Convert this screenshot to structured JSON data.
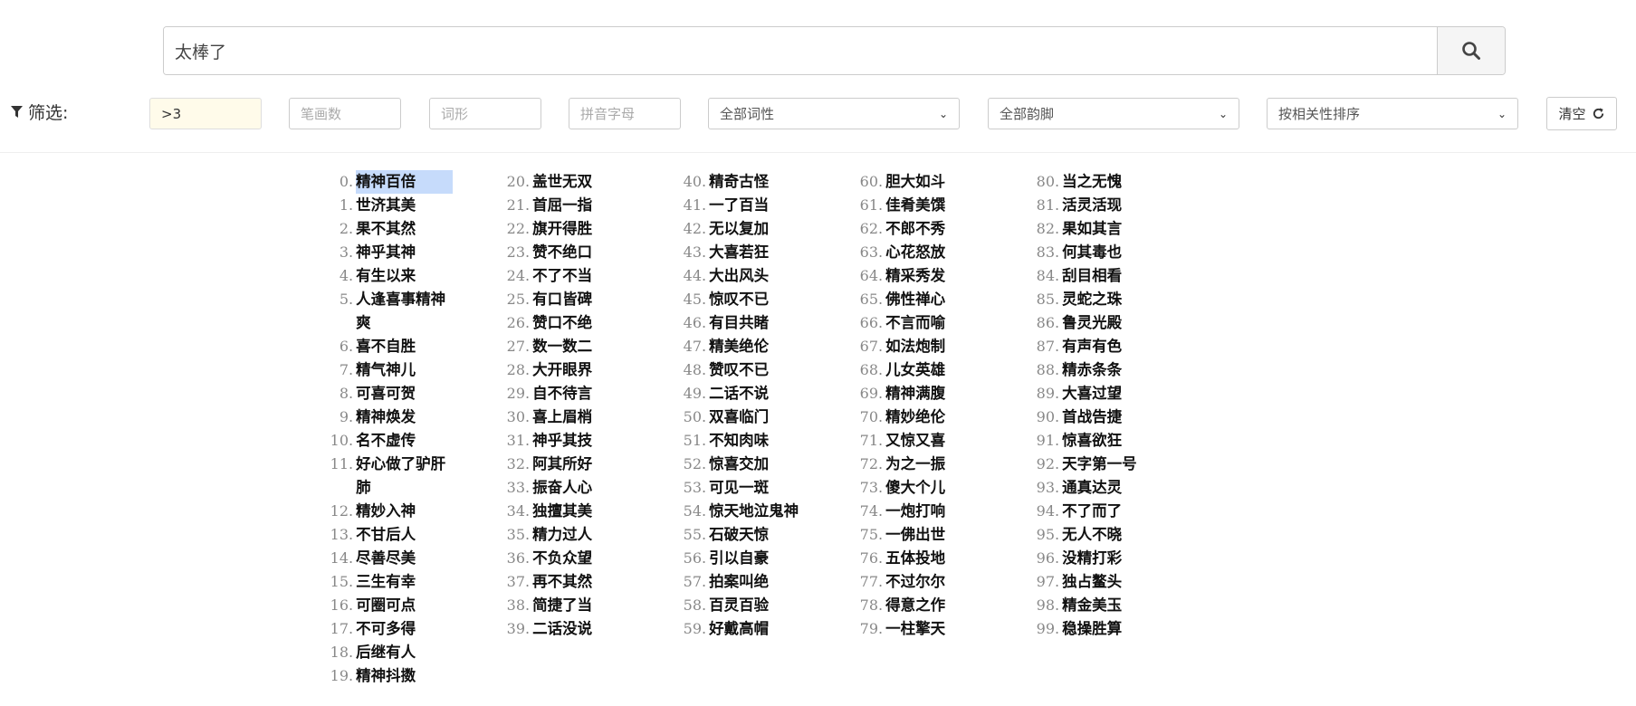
{
  "search": {
    "value": "太棒了"
  },
  "filters": {
    "label": "筛选:",
    "length_value": ">3",
    "strokes_placeholder": "笔画数",
    "form_placeholder": "词形",
    "pinyin_placeholder": "拼音字母",
    "pos_select": "全部词性",
    "rhyme_select": "全部韵脚",
    "sort_select": "按相关性排序",
    "clear_label": "清空"
  },
  "columns": [
    [
      {
        "n": "0",
        "w": "精神百倍",
        "highlight": true
      },
      {
        "n": "1",
        "w": "世济其美"
      },
      {
        "n": "2",
        "w": "果不其然"
      },
      {
        "n": "3",
        "w": "神乎其神"
      },
      {
        "n": "4",
        "w": "有生以来"
      },
      {
        "n": "5",
        "w": "人逢喜事精神爽"
      },
      {
        "n": "6",
        "w": "喜不自胜"
      },
      {
        "n": "7",
        "w": "精气神儿"
      },
      {
        "n": "8",
        "w": "可喜可贺"
      },
      {
        "n": "9",
        "w": "精神焕发"
      },
      {
        "n": "10",
        "w": "名不虚传"
      },
      {
        "n": "11",
        "w": "好心做了驴肝肺"
      },
      {
        "n": "12",
        "w": "精妙入神"
      },
      {
        "n": "13",
        "w": "不甘后人"
      },
      {
        "n": "14",
        "w": "尽善尽美"
      },
      {
        "n": "15",
        "w": "三生有幸"
      },
      {
        "n": "16",
        "w": "可圈可点"
      },
      {
        "n": "17",
        "w": "不可多得"
      },
      {
        "n": "18",
        "w": "后继有人"
      },
      {
        "n": "19",
        "w": "精神抖擞"
      }
    ],
    [
      {
        "n": "20",
        "w": "盖世无双"
      },
      {
        "n": "21",
        "w": "首屈一指"
      },
      {
        "n": "22",
        "w": "旗开得胜"
      },
      {
        "n": "23",
        "w": "赞不绝口"
      },
      {
        "n": "24",
        "w": "不了不当"
      },
      {
        "n": "25",
        "w": "有口皆碑"
      },
      {
        "n": "26",
        "w": "赞口不绝"
      },
      {
        "n": "27",
        "w": "数一数二"
      },
      {
        "n": "28",
        "w": "大开眼界"
      },
      {
        "n": "29",
        "w": "自不待言"
      },
      {
        "n": "30",
        "w": "喜上眉梢"
      },
      {
        "n": "31",
        "w": "神乎其技"
      },
      {
        "n": "32",
        "w": "阿其所好"
      },
      {
        "n": "33",
        "w": "振奋人心"
      },
      {
        "n": "34",
        "w": "独擅其美"
      },
      {
        "n": "35",
        "w": "精力过人"
      },
      {
        "n": "36",
        "w": "不负众望"
      },
      {
        "n": "37",
        "w": "再不其然"
      },
      {
        "n": "38",
        "w": "简捷了当"
      },
      {
        "n": "39",
        "w": "二话没说"
      }
    ],
    [
      {
        "n": "40",
        "w": "精奇古怪"
      },
      {
        "n": "41",
        "w": "一了百当"
      },
      {
        "n": "42",
        "w": "无以复加"
      },
      {
        "n": "43",
        "w": "大喜若狂"
      },
      {
        "n": "44",
        "w": "大出风头"
      },
      {
        "n": "45",
        "w": "惊叹不已"
      },
      {
        "n": "46",
        "w": "有目共睹"
      },
      {
        "n": "47",
        "w": "精美绝伦"
      },
      {
        "n": "48",
        "w": "赞叹不已"
      },
      {
        "n": "49",
        "w": "二话不说"
      },
      {
        "n": "50",
        "w": "双喜临门"
      },
      {
        "n": "51",
        "w": "不知肉味"
      },
      {
        "n": "52",
        "w": "惊喜交加"
      },
      {
        "n": "53",
        "w": "可见一斑"
      },
      {
        "n": "54",
        "w": "惊天地泣鬼神"
      },
      {
        "n": "55",
        "w": "石破天惊"
      },
      {
        "n": "56",
        "w": "引以自豪"
      },
      {
        "n": "57",
        "w": "拍案叫绝"
      },
      {
        "n": "58",
        "w": "百灵百验"
      },
      {
        "n": "59",
        "w": "好戴高帽"
      }
    ],
    [
      {
        "n": "60",
        "w": "胆大如斗"
      },
      {
        "n": "61",
        "w": "佳肴美馔"
      },
      {
        "n": "62",
        "w": "不郎不秀"
      },
      {
        "n": "63",
        "w": "心花怒放"
      },
      {
        "n": "64",
        "w": "精采秀发"
      },
      {
        "n": "65",
        "w": "佛性禅心"
      },
      {
        "n": "66",
        "w": "不言而喻"
      },
      {
        "n": "67",
        "w": "如法炮制"
      },
      {
        "n": "68",
        "w": "儿女英雄"
      },
      {
        "n": "69",
        "w": "精神满腹"
      },
      {
        "n": "70",
        "w": "精妙绝伦"
      },
      {
        "n": "71",
        "w": "又惊又喜"
      },
      {
        "n": "72",
        "w": "为之一振"
      },
      {
        "n": "73",
        "w": "傻大个儿"
      },
      {
        "n": "74",
        "w": "一炮打响"
      },
      {
        "n": "75",
        "w": "一佛出世"
      },
      {
        "n": "76",
        "w": "五体投地"
      },
      {
        "n": "77",
        "w": "不过尔尔"
      },
      {
        "n": "78",
        "w": "得意之作"
      },
      {
        "n": "79",
        "w": "一柱擎天"
      }
    ],
    [
      {
        "n": "80",
        "w": "当之无愧"
      },
      {
        "n": "81",
        "w": "活灵活现"
      },
      {
        "n": "82",
        "w": "果如其言"
      },
      {
        "n": "83",
        "w": "何其毒也"
      },
      {
        "n": "84",
        "w": "刮目相看"
      },
      {
        "n": "85",
        "w": "灵蛇之珠"
      },
      {
        "n": "86",
        "w": "鲁灵光殿"
      },
      {
        "n": "87",
        "w": "有声有色"
      },
      {
        "n": "88",
        "w": "精赤条条"
      },
      {
        "n": "89",
        "w": "大喜过望"
      },
      {
        "n": "90",
        "w": "首战告捷"
      },
      {
        "n": "91",
        "w": "惊喜欲狂"
      },
      {
        "n": "92",
        "w": "天字第一号"
      },
      {
        "n": "93",
        "w": "通真达灵"
      },
      {
        "n": "94",
        "w": "不了而了"
      },
      {
        "n": "95",
        "w": "无人不晓"
      },
      {
        "n": "96",
        "w": "没精打彩"
      },
      {
        "n": "97",
        "w": "独占鳌头"
      },
      {
        "n": "98",
        "w": "精金美玉"
      },
      {
        "n": "99",
        "w": "稳操胜算"
      }
    ]
  ]
}
